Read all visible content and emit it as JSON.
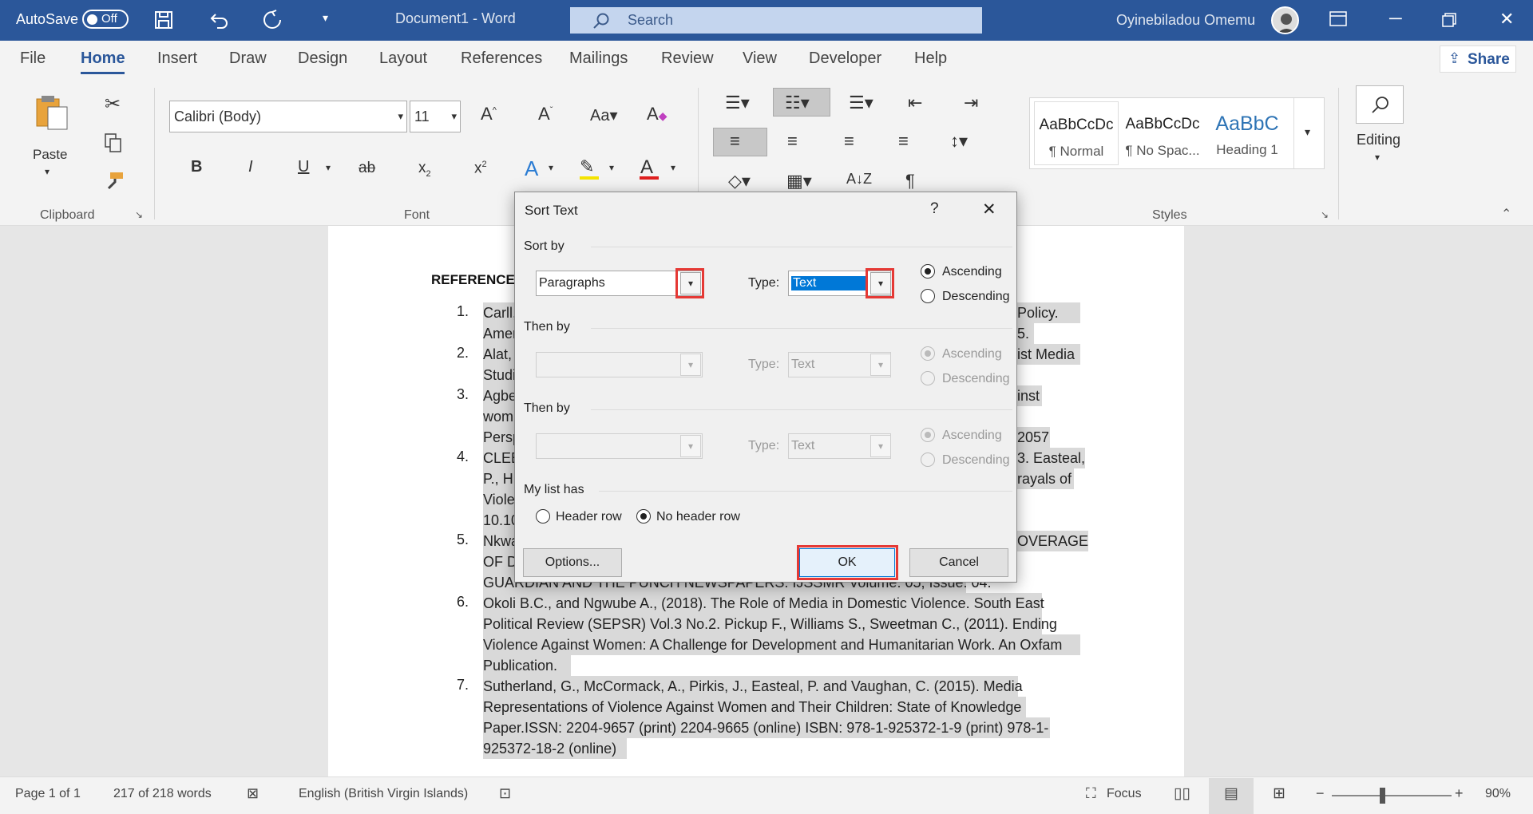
{
  "titlebar": {
    "autosave_label": "AutoSave",
    "autosave_state": "Off",
    "doc_title": "Document1  -  Word",
    "search_placeholder": "Search",
    "user_name": "Oyinebiladou Omemu"
  },
  "tabs": [
    "File",
    "Home",
    "Insert",
    "Draw",
    "Design",
    "Layout",
    "References",
    "Mailings",
    "Review",
    "View",
    "Developer",
    "Help"
  ],
  "share_label": "Share",
  "clipboard": {
    "paste_label": "Paste",
    "group_label": "Clipboard"
  },
  "font": {
    "name": "Calibri (Body)",
    "size": "11",
    "group_label": "Font",
    "bold": "B",
    "italic": "I",
    "underline": "U",
    "strike": "ab",
    "sub": "x",
    "sup": "x"
  },
  "styles": {
    "items": [
      {
        "preview": "AaBbCcDc",
        "name": "¶ Normal"
      },
      {
        "preview": "AaBbCcDc",
        "name": "¶ No Spac..."
      },
      {
        "preview": "AaBbC",
        "name": "Heading 1"
      }
    ],
    "group_label": "Styles"
  },
  "editing_label": "Editing",
  "document": {
    "heading": "REFERENCES",
    "numbers": [
      "1.",
      "2.",
      "3.",
      "4.",
      "5.",
      "6.",
      "7."
    ],
    "lines": [
      "Carll,",
      "Amer",
      "Alat,",
      "Studi",
      "Agbe",
      "wom",
      "Persp",
      "CLEE",
      "P., H",
      "Viole",
      "10.10",
      "Nkwa",
      "OF D",
      "GUARDIAN AND THE PUNCH NEWSPAPERS. IJSSMR Volume: 05, Issue: 04.",
      "Okoli B.C., and Ngwube A., (2018). The Role of Media in Domestic Violence. South East",
      "Political Review (SEPSR) Vol.3 No.2. Pickup F., Williams S., Sweetman C., (2011). Ending",
      "Violence Against Women: A Challenge for Development and Humanitarian Work. An Oxfam",
      "Publication.",
      "Sutherland, G., McCormack, A., Pirkis, J., Easteal, P. and Vaughan, C. (2015). Media",
      "Representations of Violence Against Women and Their Children: State of Knowledge",
      "Paper.ISSN: 2204-9657 (print) 2204-9665 (online) ISBN: 978-1-925372-1-9 (print) 978-1-",
      "925372-18-2 (online)"
    ],
    "right_fragments": [
      "Policy.",
      "5.",
      "ist Media",
      "inst",
      "2057",
      "3. Easteal,",
      "rayals of",
      "OVERAGE"
    ]
  },
  "dialog": {
    "title": "Sort Text",
    "help": "?",
    "sort_by_label": "Sort by",
    "sort_by_value": "Paragraphs",
    "type_label": "Type:",
    "type_value": "Text",
    "ascending": "Ascending",
    "descending": "Descending",
    "then_by_label": "Then by",
    "type_value_2": "Text",
    "type_value_3": "Text",
    "list_label": "My list has",
    "header_row": "Header row",
    "no_header_row": "No header row",
    "options_btn": "Options...",
    "ok_btn": "OK",
    "cancel_btn": "Cancel"
  },
  "status": {
    "page": "Page 1 of 1",
    "words": "217 of 218 words",
    "language": "English (British Virgin Islands)",
    "focus": "Focus",
    "zoom": "90%"
  }
}
